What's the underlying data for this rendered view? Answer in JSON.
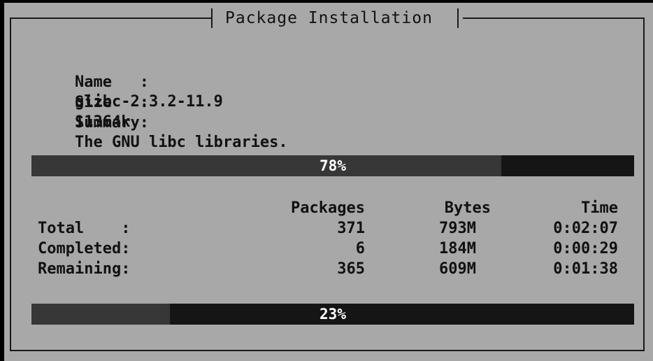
{
  "window": {
    "title": "Package Installation"
  },
  "package": {
    "name_label": "Name   :",
    "name_value": "glibc-2.3.2-11.9",
    "size_label": "Size   :",
    "size_value": "11364k",
    "summary_label": "Summary:",
    "summary_value": "The GNU libc libraries."
  },
  "package_progress": {
    "label": "78%",
    "fraction": 0.78
  },
  "stats": {
    "headers": {
      "packages": "Packages",
      "bytes": "Bytes",
      "time": "Time"
    },
    "rows": [
      {
        "label": "Total    :",
        "packages": "371",
        "bytes": "793M",
        "time": "0:02:07"
      },
      {
        "label": "Completed:",
        "packages": "6",
        "bytes": "184M",
        "time": "0:00:29"
      },
      {
        "label": "Remaining:",
        "packages": "365",
        "bytes": "609M",
        "time": "0:01:38"
      }
    ]
  },
  "overall_progress": {
    "label": "23%",
    "fraction": 0.23
  },
  "colors": {
    "background": "#a8a8a8",
    "screen": "#000000",
    "bar_empty": "#151515",
    "bar_fill": "#373737",
    "bar_text": "#ffffff"
  }
}
